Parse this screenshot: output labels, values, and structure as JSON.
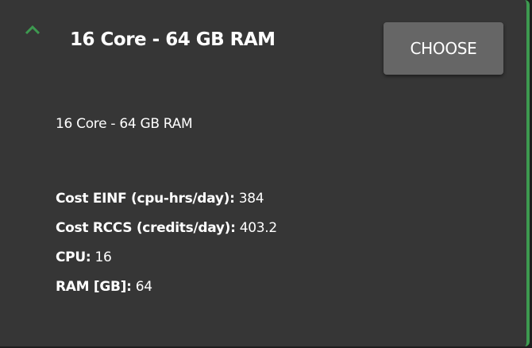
{
  "header": {
    "title": "16 Core - 64 GB RAM",
    "choose_label": "CHOOSE"
  },
  "subtitle": "16 Core - 64 GB RAM",
  "details": [
    {
      "label": "Cost EINF (cpu-hrs/day):",
      "value": "384"
    },
    {
      "label": "Cost RCCS (credits/day):",
      "value": "403.2"
    },
    {
      "label": "CPU:",
      "value": "16"
    },
    {
      "label": "RAM [GB]:",
      "value": "64"
    }
  ],
  "colors": {
    "accent": "#3d9a50",
    "background": "#363636",
    "button": "#666666"
  }
}
